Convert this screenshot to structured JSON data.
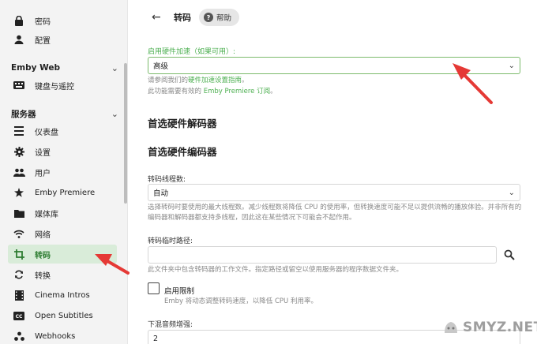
{
  "sidebar": {
    "top_items": [
      {
        "label": "密码",
        "icon": "lock-icon"
      },
      {
        "label": "配置",
        "icon": "person-icon"
      }
    ],
    "emby_web": {
      "title": "Emby Web",
      "items": [
        {
          "label": "键盘与遥控",
          "icon": "keyboard-icon"
        }
      ]
    },
    "server": {
      "title": "服务器",
      "items": [
        {
          "label": "仪表盘",
          "icon": "dashboard-icon"
        },
        {
          "label": "设置",
          "icon": "gear-icon"
        },
        {
          "label": "用户",
          "icon": "users-icon"
        },
        {
          "label": "Emby Premiere",
          "icon": "star-icon"
        },
        {
          "label": "媒体库",
          "icon": "folder-icon"
        },
        {
          "label": "网络",
          "icon": "wifi-icon"
        },
        {
          "label": "转码",
          "icon": "crop-icon"
        },
        {
          "label": "转换",
          "icon": "sync-icon"
        },
        {
          "label": "Cinema Intros",
          "icon": "film-icon"
        },
        {
          "label": "Open Subtitles",
          "icon": "cc-icon"
        },
        {
          "label": "Webhooks",
          "icon": "webhook-icon"
        }
      ]
    }
  },
  "header": {
    "back": "←",
    "title": "转码",
    "help": "帮助"
  },
  "hw_accel": {
    "label": "启用硬件加速（如果可用）:",
    "value": "高级",
    "help1_prefix": "请参阅我们的",
    "help1_link": "硬件加速设置指南",
    "help1_suffix": "。",
    "help2_prefix": "此功能需要有效的 ",
    "help2_link": "Emby Premiere 订阅",
    "help2_suffix": "。"
  },
  "sections": {
    "decoders": "首选硬件解码器",
    "encoders": "首选硬件编码器"
  },
  "threads": {
    "label": "转码线程数:",
    "value": "自动",
    "help": "选择转码时要使用的最大线程数。减少线程数将降低 CPU 的使用率，但转换速度可能不足以提供流畅的播放体验。并非所有的编码器和解码器都支持多线程，因此这在某些情况下可能会不起作用。"
  },
  "temp_path": {
    "label": "转码临时路径:",
    "value": "",
    "help": "此文件夹中包含转码器的工作文件。指定路径或留空以使用服务器的程序数据文件夹。"
  },
  "throttle": {
    "label": "启用限制",
    "help": "Emby 将动态调整转码速度，以降低 CPU 利用率。"
  },
  "downmix": {
    "label": "下混音频增强:",
    "value": "2"
  },
  "watermark": "SMYZ.NET",
  "colors": {
    "accent": "#4caf50",
    "arrow": "#e53935"
  }
}
